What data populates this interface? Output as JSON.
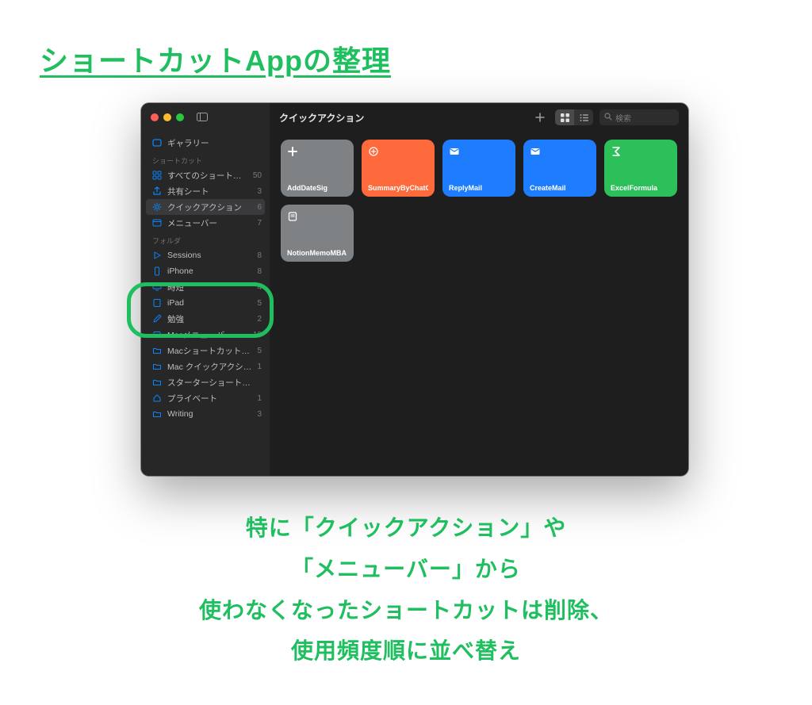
{
  "page": {
    "title": "ショートカットAppの整理",
    "caption": "特に「クイックアクション」や\n「メニューバー」から\n使わなくなったショートカットは削除、\n使用頻度順に並べ替え"
  },
  "toolbar": {
    "title": "クイックアクション",
    "search_placeholder": "検索"
  },
  "sidebar": {
    "gallery": {
      "label": "ギャラリー"
    },
    "section1_header": "ショートカット",
    "section1": [
      {
        "label": "すべてのショートカット",
        "count": "50",
        "icon": "all"
      },
      {
        "label": "共有シート",
        "count": "3",
        "icon": "share"
      },
      {
        "label": "クイックアクション",
        "count": "6",
        "icon": "gear",
        "selected": true
      },
      {
        "label": "メニューバー",
        "count": "7",
        "icon": "menubar"
      }
    ],
    "section2_header": "フォルダ",
    "section2": [
      {
        "label": "Sessions",
        "count": "8",
        "icon": "play"
      },
      {
        "label": "iPhone",
        "count": "8",
        "icon": "phone"
      },
      {
        "label": "時短",
        "count": "4",
        "icon": "display"
      },
      {
        "label": "iPad",
        "count": "5",
        "icon": "tablet"
      },
      {
        "label": "勉強",
        "count": "2",
        "icon": "pencil"
      },
      {
        "label": "Macメニューバー",
        "count": "10",
        "icon": "laptop"
      },
      {
        "label": "Macショートカットキー",
        "count": "5",
        "icon": "folder"
      },
      {
        "label": "Mac クイックアクション",
        "count": "1",
        "icon": "folder"
      },
      {
        "label": "スターターショートカット",
        "count": "",
        "icon": "folder"
      },
      {
        "label": "プライベート",
        "count": "1",
        "icon": "home"
      },
      {
        "label": "Writing",
        "count": "3",
        "icon": "folder"
      }
    ]
  },
  "tiles": [
    {
      "label": "AddDateSig",
      "color": "gray",
      "icon": "plus"
    },
    {
      "label": "SummaryByChatGPT",
      "color": "orange",
      "icon": "sparkle"
    },
    {
      "label": "ReplyMail",
      "color": "blue",
      "icon": "mail"
    },
    {
      "label": "CreateMail",
      "color": "blue",
      "icon": "mail"
    },
    {
      "label": "ExcelFormula",
      "color": "green",
      "icon": "sigma"
    },
    {
      "label": "NotionMemoMBA",
      "color": "gray",
      "icon": "note"
    }
  ]
}
